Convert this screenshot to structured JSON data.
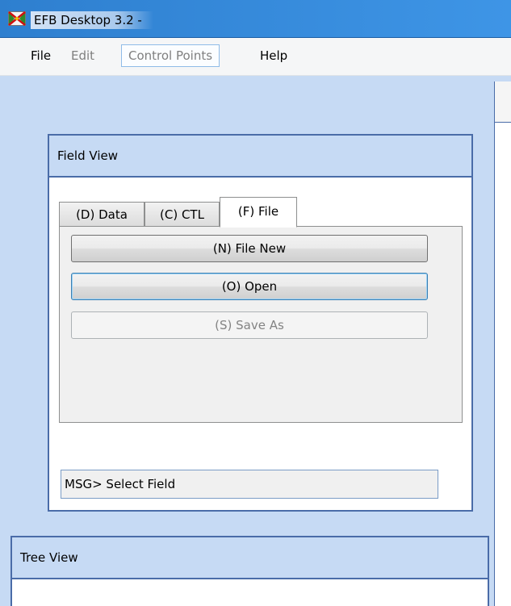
{
  "window": {
    "title": "EFB Desktop 3.2 -"
  },
  "menubar": {
    "items": [
      {
        "label": "File",
        "state": "normal"
      },
      {
        "label": "Edit",
        "state": "disabled"
      },
      {
        "label": "Control Points",
        "state": "hover"
      },
      {
        "label": "Help",
        "state": "normal"
      }
    ]
  },
  "field_view": {
    "title": "Field View",
    "tabs": [
      {
        "label": "(D) Data",
        "active": false
      },
      {
        "label": "(C) CTL",
        "active": false
      },
      {
        "label": "(F) File",
        "active": true
      }
    ],
    "buttons": {
      "file_new": "(N) File New",
      "open": "(O) Open",
      "save_as": "(S) Save As"
    },
    "message": "MSG> Select Field"
  },
  "tree_view": {
    "title": "Tree View"
  },
  "icons": {
    "app": "efb-app-icon"
  },
  "colors": {
    "background": "#c6daf4",
    "group_border": "#4a6ca8",
    "titlebar": "#3e95e6"
  }
}
